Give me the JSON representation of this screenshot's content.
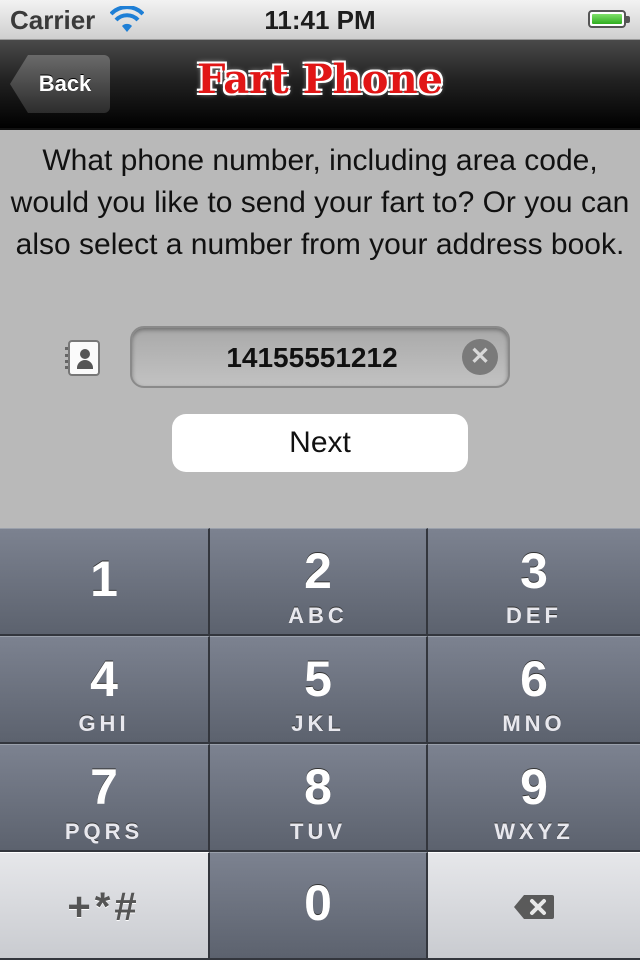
{
  "status_bar": {
    "carrier": "Carrier",
    "time": "11:41 PM"
  },
  "nav": {
    "back_label": "Back",
    "title": "Fart Phone"
  },
  "content": {
    "prompt": "What phone number, including area code, would you like to send your fart to? Or you can also select a number from your address book.",
    "phone_value": "14155551212",
    "next_label": "Next"
  },
  "keypad": {
    "keys": [
      {
        "digit": "1",
        "letters": ""
      },
      {
        "digit": "2",
        "letters": "ABC"
      },
      {
        "digit": "3",
        "letters": "DEF"
      },
      {
        "digit": "4",
        "letters": "GHI"
      },
      {
        "digit": "5",
        "letters": "JKL"
      },
      {
        "digit": "6",
        "letters": "MNO"
      },
      {
        "digit": "7",
        "letters": "PQRS"
      },
      {
        "digit": "8",
        "letters": "TUV"
      },
      {
        "digit": "9",
        "letters": "WXYZ"
      }
    ],
    "symbols": "+*#",
    "zero": "0"
  },
  "icons": {
    "wifi": "wifi-icon",
    "battery": "battery-icon",
    "contacts": "contacts-icon",
    "clear": "clear-icon",
    "backspace": "backspace-icon"
  },
  "colors": {
    "title_red": "#e11616",
    "battery_green": "#2fae1f",
    "keypad_key": "#5c626e"
  }
}
